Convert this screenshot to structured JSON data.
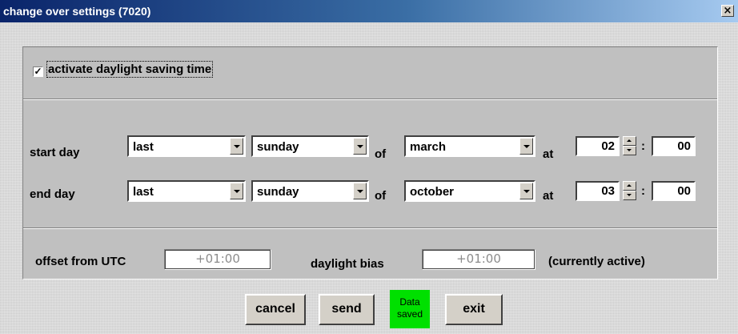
{
  "window": {
    "title": "change over settings (7020)",
    "close_glyph": "×"
  },
  "dst": {
    "checkbox_label": "activate daylight saving time",
    "checked": true,
    "check_glyph": "✓"
  },
  "start": {
    "label": "start day",
    "occurrence": "last",
    "weekday": "sunday",
    "of_label": "of",
    "month": "march",
    "at_label": "at",
    "hour": "02",
    "colon": ":",
    "minute": "00"
  },
  "end": {
    "label": "end day",
    "occurrence": "last",
    "weekday": "sunday",
    "of_label": "of",
    "month": "october",
    "at_label": "at",
    "hour": "03",
    "colon": ":",
    "minute": "00"
  },
  "offset": {
    "label": "offset from UTC",
    "value": "+01:00",
    "bias_label": "daylight bias",
    "bias_value": "+01:00",
    "active_label": "(currently active)"
  },
  "buttons": {
    "cancel": "cancel",
    "send": "send",
    "exit": "exit"
  },
  "status": {
    "line1": "Data",
    "line2": "saved",
    "color": "#00e000"
  },
  "icons": [
    "close-icon",
    "dropdown-arrow-icon",
    "spin-up-icon",
    "spin-down-icon",
    "checkmark-icon"
  ]
}
